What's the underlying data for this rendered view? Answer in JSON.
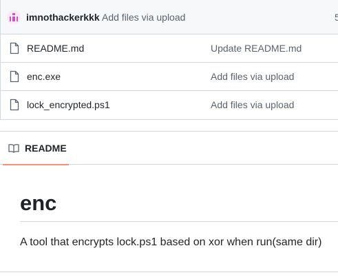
{
  "commit": {
    "author": "imnothackerkkk",
    "message": "Add files via upload",
    "truncated": "5"
  },
  "files": [
    {
      "icon": "file-icon",
      "name": "README.md",
      "commit": "Update README.md"
    },
    {
      "icon": "file-icon",
      "name": "enc.exe",
      "commit": "Add files via upload"
    },
    {
      "icon": "file-icon",
      "name": "lock_encrypted.ps1",
      "commit": "Add files via upload"
    }
  ],
  "readme": {
    "tab_icon": "book-icon",
    "tab_label": "README",
    "title": "enc",
    "paragraph": "A tool that encrypts lock.ps1 based on xor when run(same dir)"
  },
  "colors": {
    "tab_underline": "#fd8c73",
    "avatar_accent": "#c955c0",
    "muted_text": "#59636e"
  }
}
